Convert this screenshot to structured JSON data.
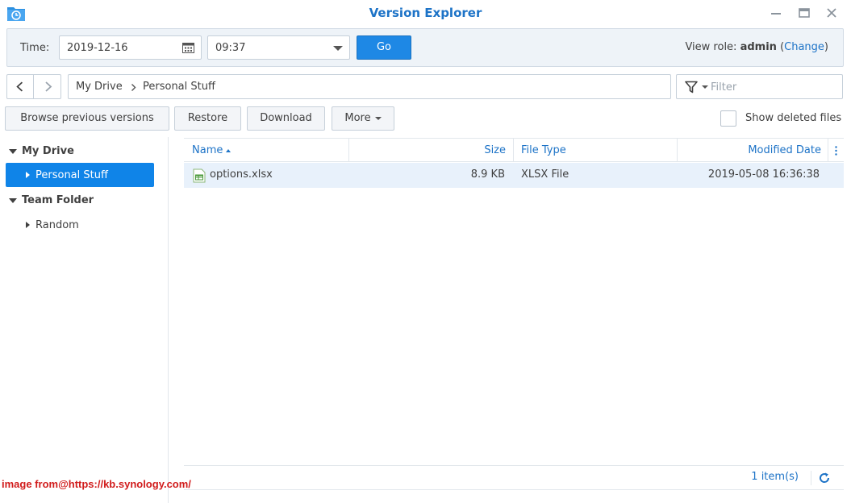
{
  "window": {
    "title": "Version Explorer"
  },
  "time_panel": {
    "time_label": "Time:",
    "date_value": "2019-12-16",
    "time_value": "09:37",
    "go_label": "Go",
    "view_role_label": "View role:",
    "view_role_user": "admin",
    "change_label": "Change",
    "paren_open": "(",
    "paren_close": ")"
  },
  "breadcrumb": {
    "items": [
      "My Drive",
      "Personal Stuff"
    ]
  },
  "filter": {
    "placeholder": "Filter"
  },
  "toolbar": {
    "browse_label": "Browse previous versions",
    "restore_label": "Restore",
    "download_label": "Download",
    "more_label": "More",
    "show_deleted_label": "Show deleted files"
  },
  "sidebar": {
    "items": [
      {
        "label": "My Drive",
        "level": 0,
        "expanded": true
      },
      {
        "label": "Personal Stuff",
        "level": 1,
        "selected": true
      },
      {
        "label": "Team Folder",
        "level": 0,
        "expanded": true
      },
      {
        "label": "Random",
        "level": 1
      }
    ]
  },
  "grid": {
    "columns": {
      "name": "Name",
      "size": "Size",
      "type": "File Type",
      "modified": "Modified Date"
    },
    "rows": [
      {
        "name": "options.xlsx",
        "size": "8.9 KB",
        "type": "XLSX File",
        "modified": "2019-05-08 16:36:38",
        "icon": "spreadsheet-file-icon"
      }
    ]
  },
  "footer": {
    "item_count": "1 item(s)"
  },
  "watermark": "image from@https://kb.synology.com/",
  "colors": {
    "accent": "#1d73c7",
    "go_button": "#1e88e5",
    "selected": "#0f84e8",
    "row_highlight": "#e8f1fb",
    "watermark": "#d11c1c"
  }
}
